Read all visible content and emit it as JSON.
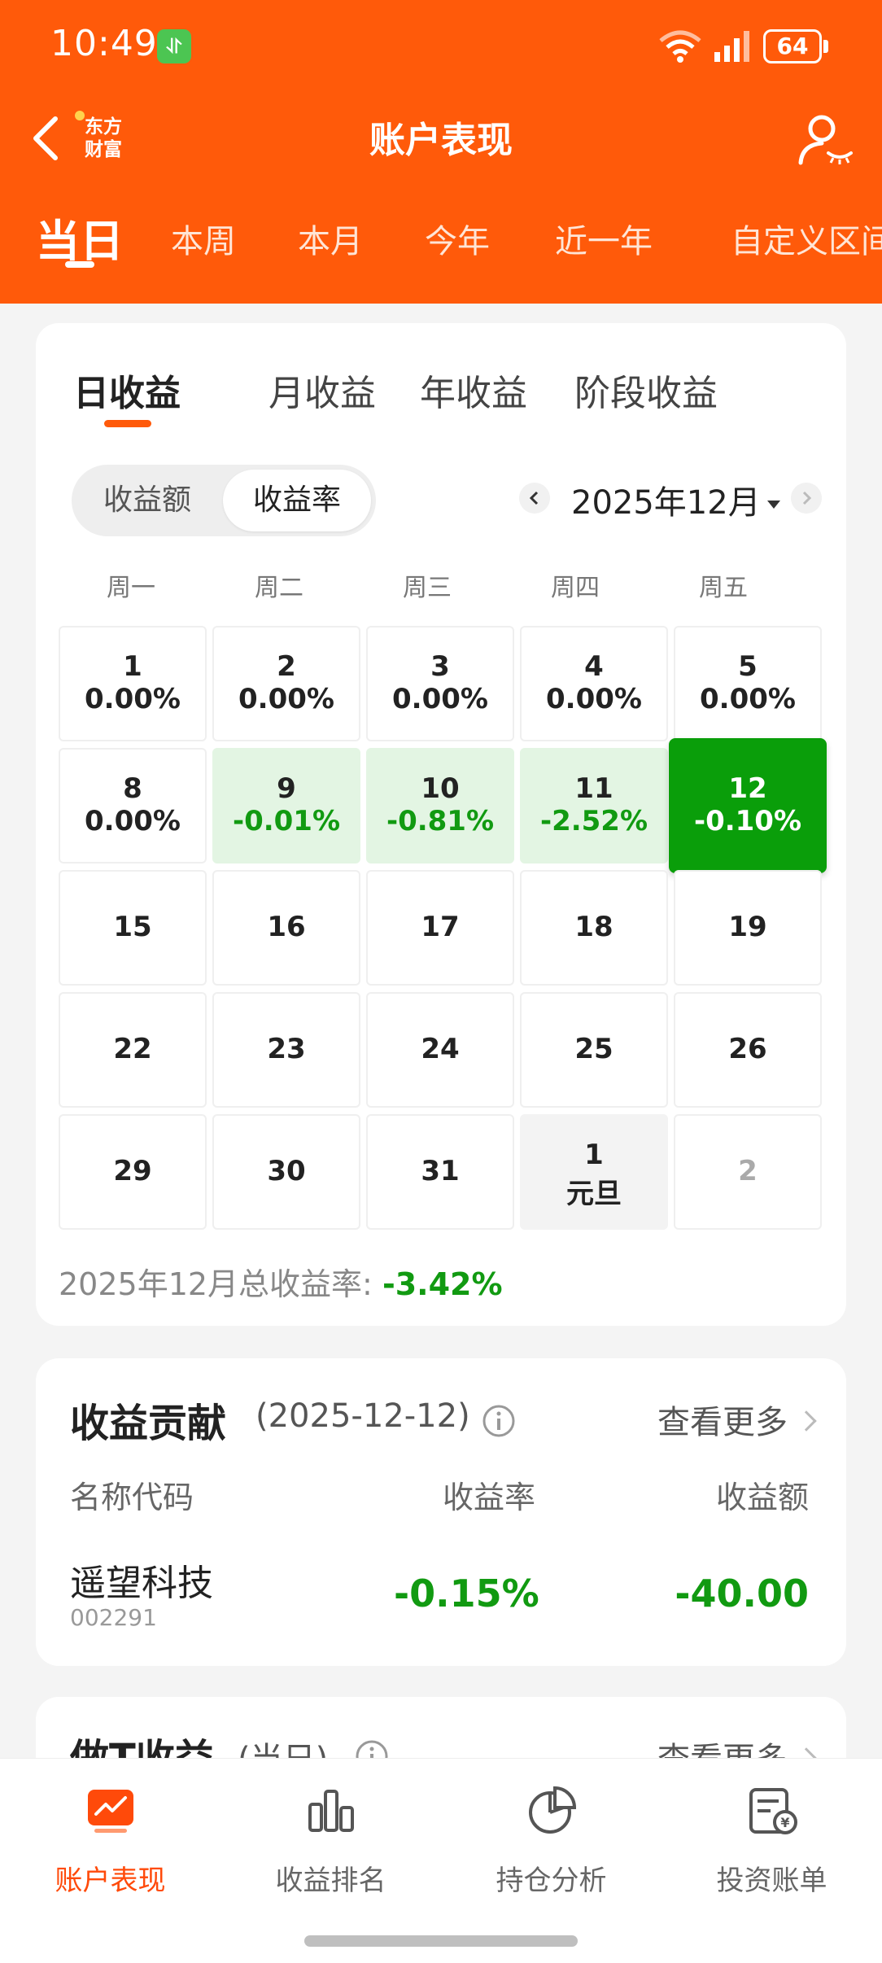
{
  "status_bar": {
    "time": "10:49",
    "badge": "⥯",
    "battery": "64"
  },
  "nav": {
    "title": "账户表现",
    "logo_line1": "东方",
    "logo_line2": "财富"
  },
  "period_tabs": [
    "当日",
    "本周",
    "本月",
    "今年",
    "近一年",
    "自定义区间"
  ],
  "sub_tabs": [
    "日收益",
    "月收益",
    "年收益",
    "阶段收益"
  ],
  "toggle": {
    "amount": "收益额",
    "rate": "收益率"
  },
  "month_label": "2025年12月",
  "weekdays": [
    "周一",
    "周二",
    "周三",
    "周四",
    "周五"
  ],
  "calendar": [
    [
      {
        "day": "1",
        "value": "0.00%"
      },
      {
        "day": "2",
        "value": "0.00%"
      },
      {
        "day": "3",
        "value": "0.00%"
      },
      {
        "day": "4",
        "value": "0.00%"
      },
      {
        "day": "5",
        "value": "0.00%"
      }
    ],
    [
      {
        "day": "8",
        "value": "0.00%"
      },
      {
        "day": "9",
        "value": "-0.01%"
      },
      {
        "day": "10",
        "value": "-0.81%"
      },
      {
        "day": "11",
        "value": "-2.52%"
      },
      {
        "day": "12",
        "value": "-0.10%"
      }
    ],
    [
      {
        "day": "15"
      },
      {
        "day": "16"
      },
      {
        "day": "17"
      },
      {
        "day": "18"
      },
      {
        "day": "19"
      }
    ],
    [
      {
        "day": "22"
      },
      {
        "day": "23"
      },
      {
        "day": "24"
      },
      {
        "day": "25"
      },
      {
        "day": "26"
      }
    ],
    [
      {
        "day": "29"
      },
      {
        "day": "30"
      },
      {
        "day": "31"
      },
      {
        "day": "1",
        "note": "元旦"
      },
      {
        "day": "2"
      }
    ]
  ],
  "total": {
    "label": "2025年12月总收益率: ",
    "value": "-3.42%"
  },
  "contribution": {
    "title": "收益贡献",
    "date": "(2025-12-12)",
    "more": "查看更多",
    "headers": {
      "name": "名称代码",
      "rate": "收益率",
      "amount": "收益额"
    },
    "row": {
      "name": "遥望科技",
      "code": "002291",
      "rate": "-0.15%",
      "amount": "-40.00"
    }
  },
  "t_section": {
    "title": "做T收益",
    "sub": "(当日)",
    "more": "查看更多"
  },
  "bottom_nav": [
    "账户表现",
    "收益排名",
    "持仓分析",
    "投资账单"
  ],
  "colors": {
    "brand": "#ff5a0a",
    "gain_down": "#119a11",
    "cell_light": "#e3f5e3",
    "cell_dark": "#0a9e0a"
  }
}
